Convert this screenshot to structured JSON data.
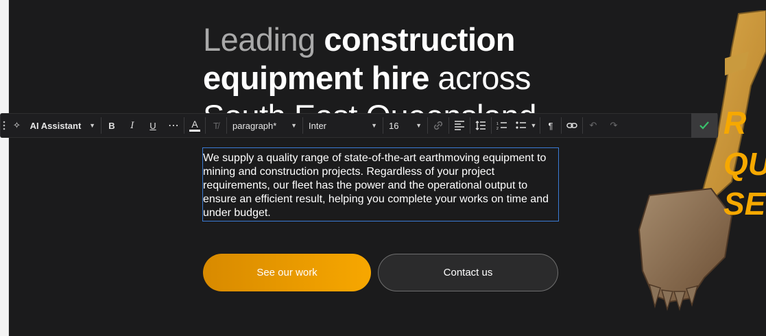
{
  "hero": {
    "heading_light": "Leading ",
    "heading_bold": "construction equipment hire",
    "heading_rest": " across South East Queensland",
    "paragraph": "We supply a quality range of state-of-the-art earthmoving equipment to mining and construction projects. Regardless of your project requirements, our fleet has the power and the operational output to ensure an efficient result, helping you complete your works on time and under budget.",
    "primary_button": "See our work",
    "secondary_button": "Contact us",
    "side_text": [
      "R",
      "QU",
      "SEI"
    ]
  },
  "toolbar": {
    "ai_label": "AI Assistant",
    "block_type": "paragraph*",
    "font_family": "Inter",
    "font_size": "16"
  },
  "colors": {
    "accent": "#f7a700",
    "background": "#1b1b1c",
    "selection": "#3a7bd5",
    "confirm": "#39c16c"
  }
}
